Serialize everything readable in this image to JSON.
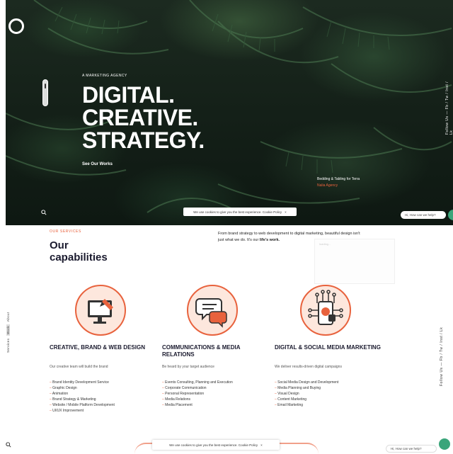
{
  "hero": {
    "kicker": "A MARKETING AGENCY",
    "headline": [
      "DIGITAL.",
      "CREATIVE.",
      "STRATEGY."
    ],
    "see_work": "See Our Works",
    "footnote_pre": "Bedding & Tabling for Terra",
    "footnote_accent": "Nalia Agency",
    "social": "Follow Us — Fb / Tw / Inst / Lk",
    "cookie_text": "We use cookies to give you the best experience. Cookie Policy",
    "cookie_close": "×",
    "chat_text": "Hi, How can we help?"
  },
  "capabilities": {
    "label": "OUR SERVICES",
    "title": "Our capabilities",
    "intro_text": "From brand strategy to web development to digital marketing, beautiful design isn't just what we do. It's our ",
    "intro_bold": "life's work.",
    "ghost_text": "loading...",
    "left_tab_items": [
      "Services",
      "Work",
      "About"
    ],
    "social": "Follow Us — Fb / Tw / Inst / Lk",
    "cards": [
      {
        "title": "CREATIVE, BRAND & WEB DESIGN",
        "desc": "Our creative team will build the brand",
        "items": [
          "Brand Identity Development Service",
          "Graphic Design",
          "Animation",
          "Brand Strategy & Marketing",
          "Website / Mobile Platform Development",
          "UI/UX Improvement"
        ]
      },
      {
        "title": "COMMUNICATIONS & MEDIA RELATIONS",
        "desc": "Be heard by your target audience",
        "items": [
          "Events Consulting, Planning and Execution",
          "Corporate Communication",
          "Personal Representation",
          "Media Relations",
          "Media Placement"
        ]
      },
      {
        "title": "DIGITAL & SOCIAL MEDIA MARKETING",
        "desc": "We deliver results-driven digital campaigns",
        "items": [
          "Social Media Design and Development",
          "Media Planning and Buying",
          "Visual Design",
          "Content Marketing",
          "Email Marketing"
        ]
      }
    ],
    "cookie_text": "We use cookies to give you the best experience. Cookie Policy",
    "cookie_close": "×",
    "chat_text": "Hi, How can we help?"
  },
  "icons": {
    "search": "search-icon",
    "chat": "chat-icon",
    "monitor": "monitor-pencil-icon",
    "speech": "speech-bubbles-icon",
    "digital": "circuit-phone-icon"
  },
  "colors": {
    "accent": "#e8623d",
    "chat_green": "#3aa57a",
    "dark_text": "#1a1a2e"
  }
}
